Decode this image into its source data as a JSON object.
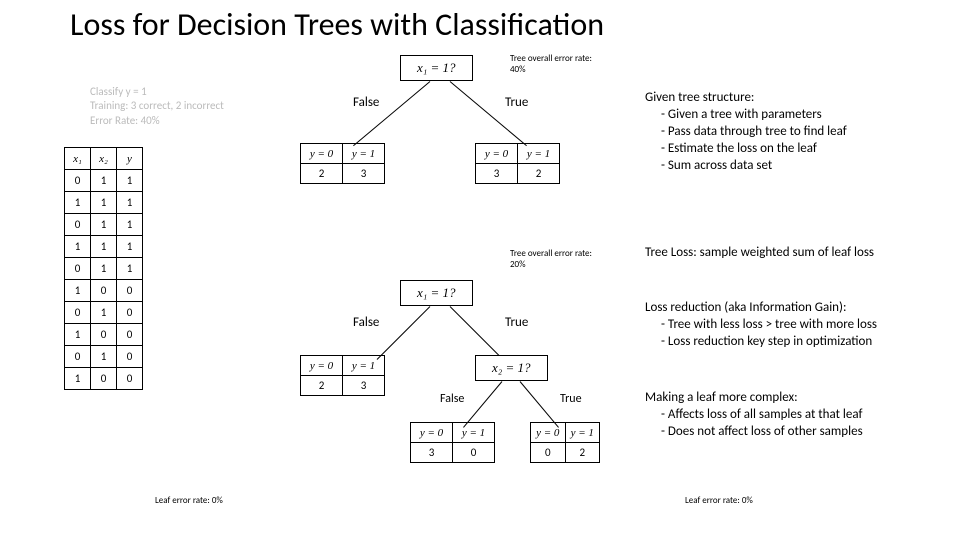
{
  "title": "Loss for Decision Trees with Classification",
  "classify": {
    "line1": "Classify y = 1",
    "line2": "Training: 3 correct, 2 incorrect",
    "line3": "Error Rate: 40%"
  },
  "data_table": {
    "headers": [
      "x₁",
      "x₂",
      "y"
    ],
    "rows": [
      [
        "0",
        "1",
        "1"
      ],
      [
        "1",
        "1",
        "1"
      ],
      [
        "0",
        "1",
        "1"
      ],
      [
        "1",
        "1",
        "1"
      ],
      [
        "0",
        "1",
        "1"
      ],
      [
        "1",
        "0",
        "0"
      ],
      [
        "0",
        "1",
        "0"
      ],
      [
        "1",
        "0",
        "0"
      ],
      [
        "0",
        "1",
        "0"
      ],
      [
        "1",
        "0",
        "0"
      ]
    ]
  },
  "tree1": {
    "err_label": "Tree overall error rate: 40%",
    "root": "x₁ = 1?",
    "false_label": "False",
    "true_label": "True",
    "left_leaf": {
      "headers": [
        "y = 0",
        "y = 1"
      ],
      "values": [
        "2",
        "3"
      ]
    },
    "right_leaf": {
      "headers": [
        "y = 0",
        "y = 1"
      ],
      "values": [
        "3",
        "2"
      ]
    }
  },
  "tree2": {
    "err_label": "Tree overall error rate: 20%",
    "root": "x₁ = 1?",
    "false_label": "False",
    "true_label": "True",
    "left_leaf": {
      "headers": [
        "y = 0",
        "y = 1"
      ],
      "values": [
        "2",
        "3"
      ]
    },
    "right_node": "x₂ = 1?",
    "right_false": "False",
    "right_true": "True",
    "sub_left": {
      "headers": [
        "y = 0",
        "y = 1"
      ],
      "values": [
        "3",
        "0"
      ]
    },
    "sub_right": {
      "headers": [
        "y = 0",
        "y = 1"
      ],
      "values": [
        "0",
        "2"
      ]
    }
  },
  "leaf_err_left": "Leaf error rate: 0%",
  "leaf_err_right": "Leaf error rate: 0%",
  "right": {
    "b1_title": "Given tree structure:",
    "b1_l1": "- Given a tree with parameters",
    "b1_l2": "- Pass data through tree to find leaf",
    "b1_l3": "- Estimate the loss on the leaf",
    "b1_l4": "- Sum across data set",
    "b2": "Tree Loss: sample weighted sum of leaf loss",
    "b3_title": "Loss reduction (aka Information Gain):",
    "b3_l1": "- Tree with less loss > tree with more loss",
    "b3_l2": "- Loss reduction key step in optimization",
    "b4_title": "Making a leaf more complex:",
    "b4_l1": "- Affects loss of all samples at that leaf",
    "b4_l2": "- Does not affect loss of other samples"
  }
}
